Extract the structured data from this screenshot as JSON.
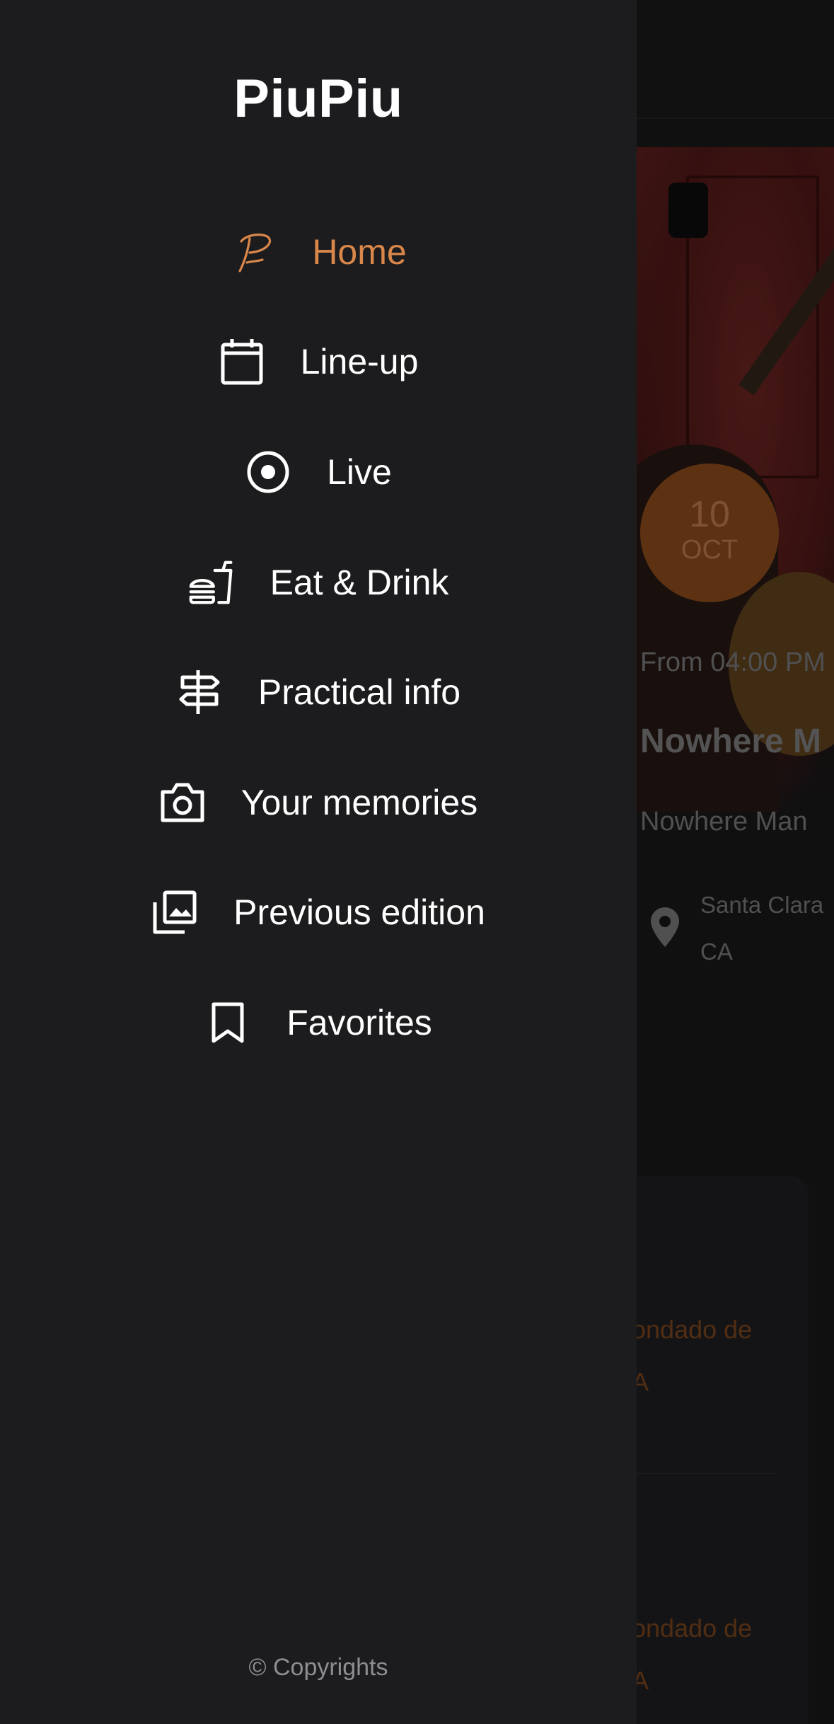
{
  "app": {
    "brand": "PiuPiu",
    "copyright": "© Copyrights",
    "accent_color": "#d9874a"
  },
  "drawer": {
    "items": [
      {
        "label": "Home",
        "icon": "piupiu-logo-icon",
        "active": true
      },
      {
        "label": "Line-up",
        "icon": "calendar-icon",
        "active": false
      },
      {
        "label": "Live",
        "icon": "live-record-icon",
        "active": false
      },
      {
        "label": "Eat & Drink",
        "icon": "fastfood-icon",
        "active": false
      },
      {
        "label": "Practical info",
        "icon": "signpost-icon",
        "active": false
      },
      {
        "label": "Your memories",
        "icon": "camera-icon",
        "active": false
      },
      {
        "label": "Previous edition",
        "icon": "photo-library-icon",
        "active": false
      },
      {
        "label": "Favorites",
        "icon": "bookmark-icon",
        "active": false
      }
    ]
  },
  "background": {
    "event": {
      "date_day": "10",
      "date_month": "OCT",
      "time": "From 04:00 PM",
      "title": "Nowhere M",
      "artist": "Nowhere Man",
      "location_line1": "Santa Clara",
      "location_line2": "CA"
    },
    "cards": [
      {
        "link_line1": "ondado de",
        "link_line2": "A"
      },
      {
        "link_line1": "ondado de",
        "link_line2": "A"
      }
    ]
  }
}
